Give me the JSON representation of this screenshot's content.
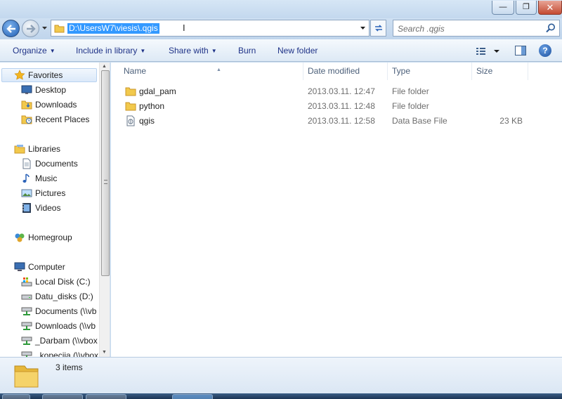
{
  "window": {
    "minimize_glyph": "—",
    "maximize_glyph": "❐",
    "close_glyph": "✕"
  },
  "nav": {
    "address_path": "D:\\UsersW7\\viesis\\.qgis",
    "search_placeholder": "Search .qgis"
  },
  "toolbar": {
    "organize": "Organize",
    "include_in_library": "Include in library",
    "share_with": "Share with",
    "burn": "Burn",
    "new_folder": "New folder"
  },
  "sidebar": {
    "favorites": "Favorites",
    "desktop": "Desktop",
    "downloads": "Downloads",
    "recent_places": "Recent Places",
    "libraries": "Libraries",
    "documents": "Documents",
    "music": "Music",
    "pictures": "Pictures",
    "videos": "Videos",
    "homegroup": "Homegroup",
    "computer": "Computer",
    "local_disk": "Local Disk (C:)",
    "datu_disks": "Datu_disks (D:)",
    "net_documents": "Documents (\\\\vb",
    "net_downloads": "Downloads (\\\\vb",
    "net_darbam": "_Darbam (\\\\vbox",
    "net_kopecija": "_kopecija (\\\\vbox"
  },
  "columns": {
    "name": "Name",
    "date_modified": "Date modified",
    "type": "Type",
    "size": "Size"
  },
  "files": [
    {
      "name": "gdal_pam",
      "date": "2013.03.11. 12:47",
      "type": "File folder",
      "size": ""
    },
    {
      "name": "python",
      "date": "2013.03.11. 12:48",
      "type": "File folder",
      "size": ""
    },
    {
      "name": "qgis",
      "date": "2013.03.11. 12:58",
      "type": "Data Base File",
      "size": "23 KB"
    }
  ],
  "status": {
    "item_count": "3 items"
  },
  "colors": {
    "selection": "#3399ff",
    "command_text": "#1e3287",
    "header_text": "#4c607a",
    "folder_yellow": "#f2c94c"
  }
}
